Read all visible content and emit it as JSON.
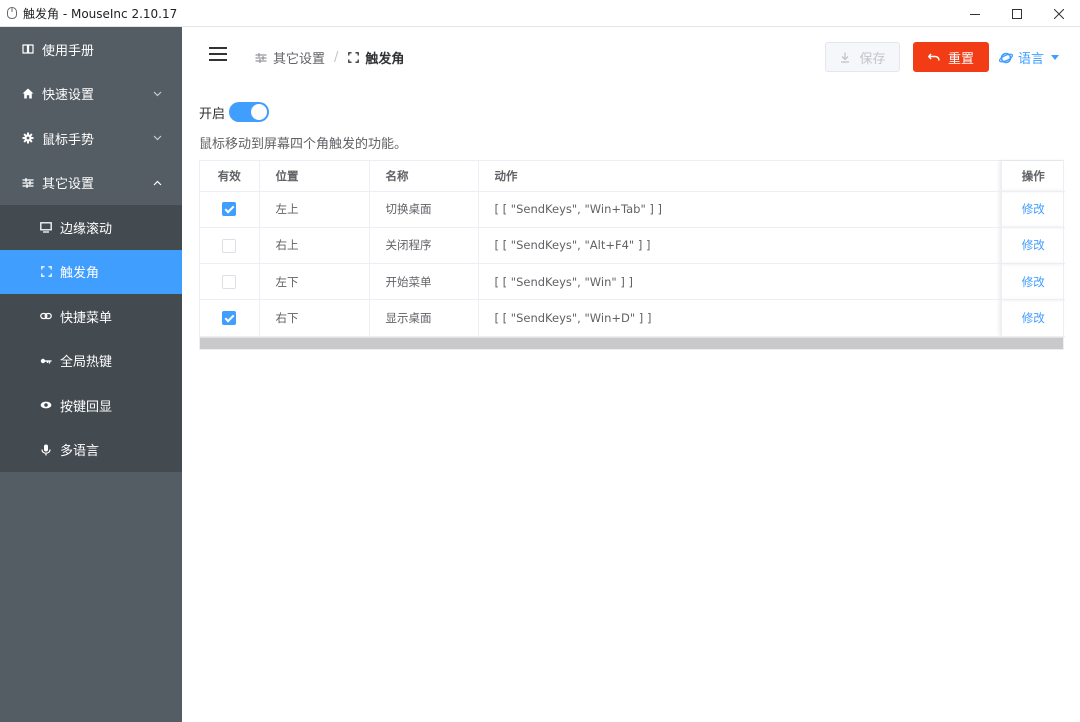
{
  "window": {
    "title": "触发角 - MouseInc 2.10.17",
    "controls": [
      "minimize-icon",
      "maximize-icon",
      "close-icon"
    ]
  },
  "sidebar": {
    "items": [
      {
        "label": "使用手册",
        "icon": "book-icon"
      },
      {
        "label": "快速设置",
        "icon": "home-icon",
        "expandable": true
      },
      {
        "label": "鼠标手势",
        "icon": "gear-icon",
        "expandable": true
      },
      {
        "label": "其它设置",
        "icon": "sliders-icon",
        "expanded": true
      }
    ],
    "subitems": [
      {
        "label": "边缘滚动",
        "icon": "monitor-icon"
      },
      {
        "label": "触发角",
        "icon": "corners-icon",
        "active": true
      },
      {
        "label": "快捷菜单",
        "icon": "link-icon"
      },
      {
        "label": "全局热键",
        "icon": "key-icon"
      },
      {
        "label": "按键回显",
        "icon": "eye-icon"
      },
      {
        "label": "多语言",
        "icon": "mic-icon"
      }
    ]
  },
  "header": {
    "breadcrumb": [
      "其它设置",
      "触发角"
    ],
    "save_label": "保存",
    "reset_label": "重置",
    "language_label": "语言"
  },
  "main": {
    "enable_label": "开启",
    "enabled": true,
    "description": "鼠标移动到屏幕四个角触发的功能。"
  },
  "table": {
    "columns": [
      "有效",
      "位置",
      "名称",
      "动作",
      "操作"
    ],
    "rows": [
      {
        "enabled": true,
        "position": "左上",
        "name": "切换桌面",
        "action": "[ [ \"SendKeys\", \"Win+Tab\" ] ]",
        "op": "修改"
      },
      {
        "enabled": false,
        "position": "右上",
        "name": "关闭程序",
        "action": "[ [ \"SendKeys\", \"Alt+F4\" ] ]",
        "op": "修改"
      },
      {
        "enabled": false,
        "position": "左下",
        "name": "开始菜单",
        "action": "[ [ \"SendKeys\", \"Win\" ] ]",
        "op": "修改"
      },
      {
        "enabled": true,
        "position": "右下",
        "name": "显示桌面",
        "action": "[ [ \"SendKeys\", \"Win+D\" ] ]",
        "op": "修改"
      }
    ]
  },
  "colors": {
    "sidebar_bg": "#545c64",
    "submenu_bg": "#434a50",
    "active_bg": "#409eff",
    "reset_button": "#f23c16",
    "link": "#409eff"
  }
}
